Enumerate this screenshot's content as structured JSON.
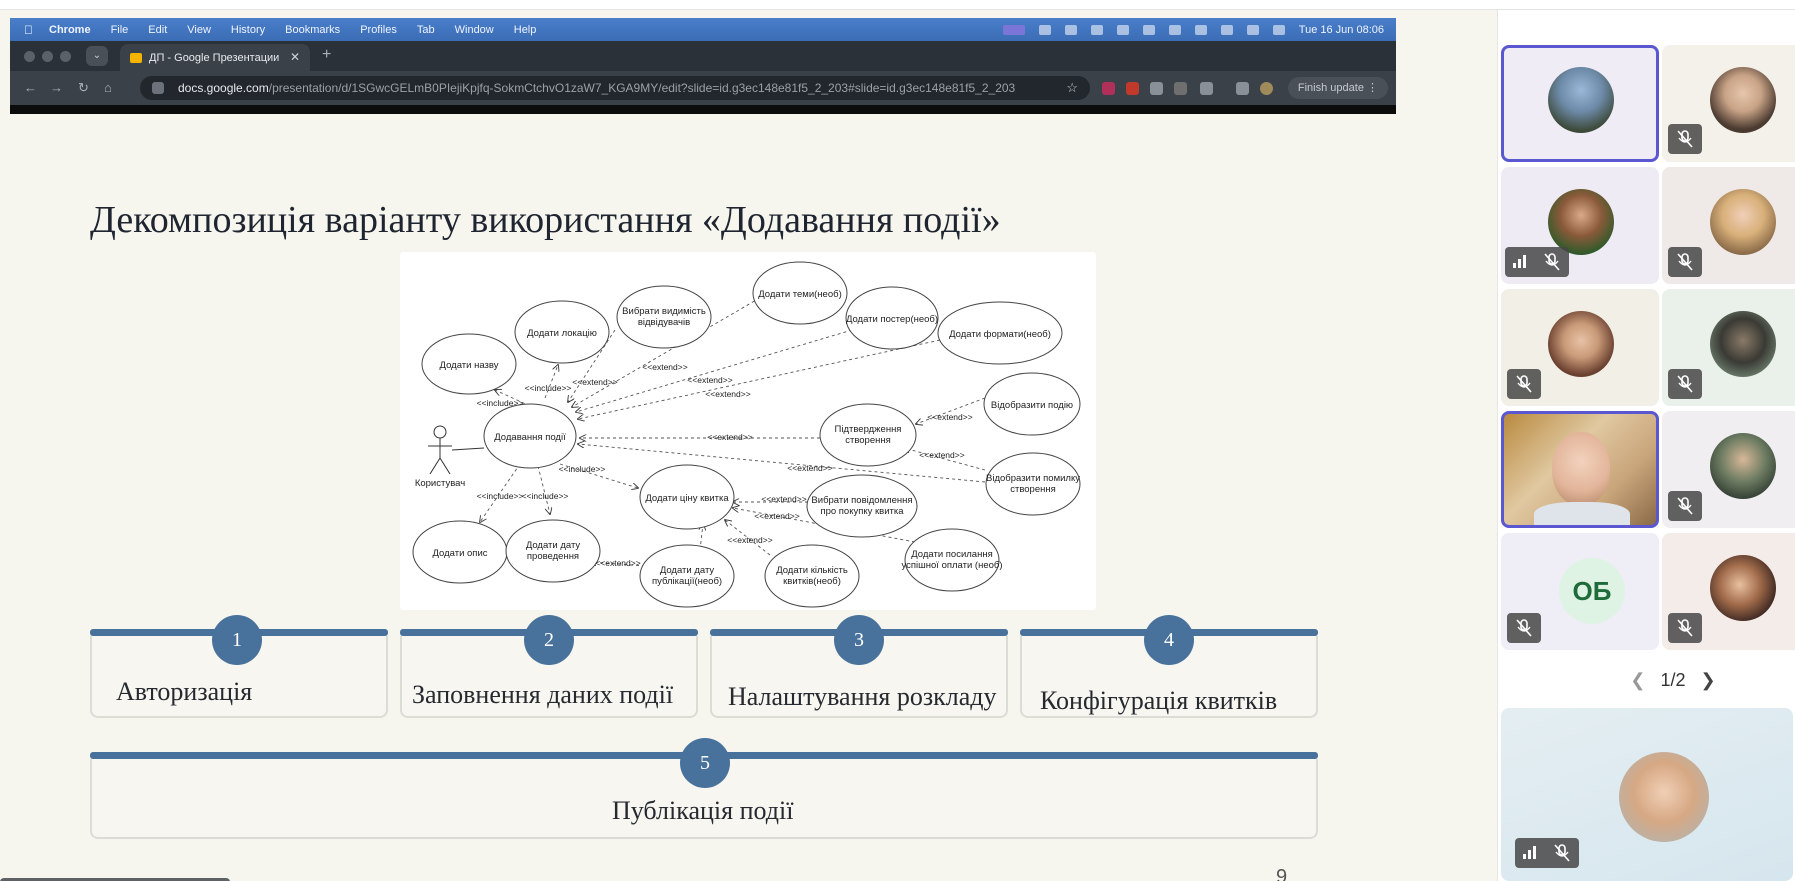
{
  "menubar": {
    "app": "Chrome",
    "items": [
      "File",
      "Edit",
      "View",
      "History",
      "Bookmarks",
      "Profiles",
      "Tab",
      "Window",
      "Help"
    ],
    "clock": "Tue 16 Jun  08:06"
  },
  "browser": {
    "tab_title": "ДП - Google Презентации",
    "url_domain": "docs.google.com",
    "url_path": "/presentation/d/1SGwcGELmB0PIejiKpjfq-SokmCtchvO1zaW7_KGA9MY/edit?slide=id.g3ec148e81f5_2_203#slide=id.g3ec148e81f5_2_203",
    "finish_update": "Finish update"
  },
  "slide": {
    "title": "Декомпозиція варіанту використання «Додавання події»",
    "page_number": "9",
    "steps": [
      {
        "num": "1",
        "label": "Авторизація"
      },
      {
        "num": "2",
        "label": "Заповнення даних події"
      },
      {
        "num": "3",
        "label": "Налаштування розкладу"
      },
      {
        "num": "4",
        "label": "Конфігурація квитків"
      },
      {
        "num": "5",
        "label": "Публікація події"
      }
    ],
    "diagram": {
      "actor": "Користувач",
      "main": "Додавання події",
      "uc_name": "Додати назву",
      "uc_location": "Додати локацію",
      "uc_visibility_1": "Вибрати видимість",
      "uc_visibility_2": "відвідувачів",
      "uc_topics": "Додати теми(необ)",
      "uc_poster": "Додати постер(необ)",
      "uc_formats": "Додати формати(необ)",
      "uc_show": "Відобразити подію",
      "uc_confirm_1": "Підтвердження",
      "uc_confirm_2": "створення",
      "uc_error_1": "Відобразити помилку",
      "uc_error_2": "створення",
      "uc_price": "Додати ціну квитка",
      "uc_msg_1": "Вибрати повідомлення",
      "uc_msg_2": "про покупку квитка",
      "uc_link_1": "Додати посилання",
      "uc_link_2": "успішної оплати (необ)",
      "uc_desc": "Додати опис",
      "uc_date_1": "Додати дату",
      "uc_date_2": "проведення",
      "uc_pubdate_1": "Додати дату",
      "uc_pubdate_2": "публікації(необ)",
      "uc_count_1": "Додати кількість",
      "uc_count_2": "квитків(необ)",
      "include": "<<include>>",
      "extend": "<<extend>>"
    }
  },
  "participants": {
    "initials": "ОБ",
    "pager": "1/2"
  },
  "colors": {
    "accent": "#48729c",
    "active_border": "#5a57d0",
    "slide_bg": "#f6f5ee"
  }
}
